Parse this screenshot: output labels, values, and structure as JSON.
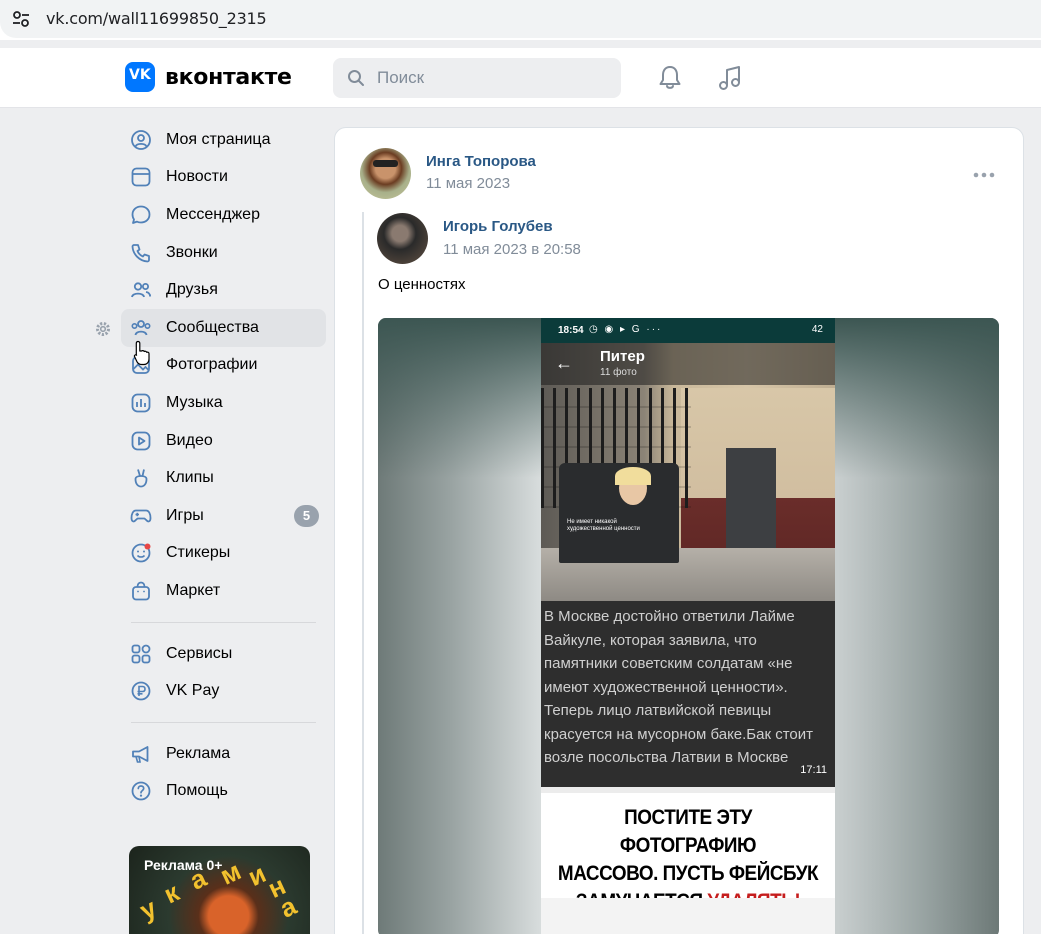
{
  "browser": {
    "url": "vk.com/wall11699850_2315"
  },
  "header": {
    "logo_text": "вконтакте",
    "search_placeholder": "Поиск",
    "colors": {
      "brand": "#0077ff",
      "link": "#2a5885",
      "muted": "#818c99"
    }
  },
  "nav": {
    "items": [
      {
        "label": "Моя страница",
        "icon": "user-circle-icon"
      },
      {
        "label": "Новости",
        "icon": "newsfeed-icon"
      },
      {
        "label": "Мессенджер",
        "icon": "message-icon"
      },
      {
        "label": "Звонки",
        "icon": "phone-icon"
      },
      {
        "label": "Друзья",
        "icon": "friends-icon"
      },
      {
        "label": "Сообщества",
        "icon": "communities-icon"
      },
      {
        "label": "Фотографии",
        "icon": "photos-icon"
      },
      {
        "label": "Музыка",
        "icon": "music-icon"
      },
      {
        "label": "Видео",
        "icon": "video-icon"
      },
      {
        "label": "Клипы",
        "icon": "clips-icon"
      },
      {
        "label": "Игры",
        "icon": "games-icon",
        "badge": "5"
      },
      {
        "label": "Стикеры",
        "icon": "stickers-icon"
      },
      {
        "label": "Маркет",
        "icon": "market-icon"
      }
    ],
    "secondary": [
      {
        "label": "Сервисы",
        "icon": "services-icon"
      },
      {
        "label": "VK Pay",
        "icon": "vkpay-icon"
      }
    ],
    "tertiary": [
      {
        "label": "Реклама",
        "icon": "megaphone-icon"
      },
      {
        "label": "Помощь",
        "icon": "help-icon"
      }
    ]
  },
  "ad": {
    "label": "Реклама 0+",
    "letters": [
      "у",
      "к",
      "а",
      "м",
      "и",
      "н",
      "а"
    ]
  },
  "post": {
    "author": "Инга Топорова",
    "date": "11 мая 2023",
    "repost": {
      "author": "Игорь Голубев",
      "date": "11 мая 2023 в 20:58",
      "text": "О ценностях"
    },
    "image": {
      "status_time": "18:54",
      "status_battery": "42",
      "album_title": "Питер",
      "album_count": "11 фото",
      "bin_caption": "Не имеет никакой художественной ценности",
      "article_text": "В Москве достойно ответили Лайме Вайкуле, которая заявила, что памятники советским солдатам «не имеют художественной ценности». Теперь лицо латвийской певицы красуется на мусорном баке.Бак стоит возле посольства Латвии в Москве",
      "video_time": "17:11",
      "meme_line1": "ПОСТИТЕ ЭТУ ФОТОГРАФИЮ",
      "meme_line2": "МАССОВО. ПУСТЬ ФЕЙСБУК",
      "meme_line3a": "ЗАМУЧАЕТСЯ",
      "meme_line3b": "УДАЛЯТЬ!"
    }
  }
}
